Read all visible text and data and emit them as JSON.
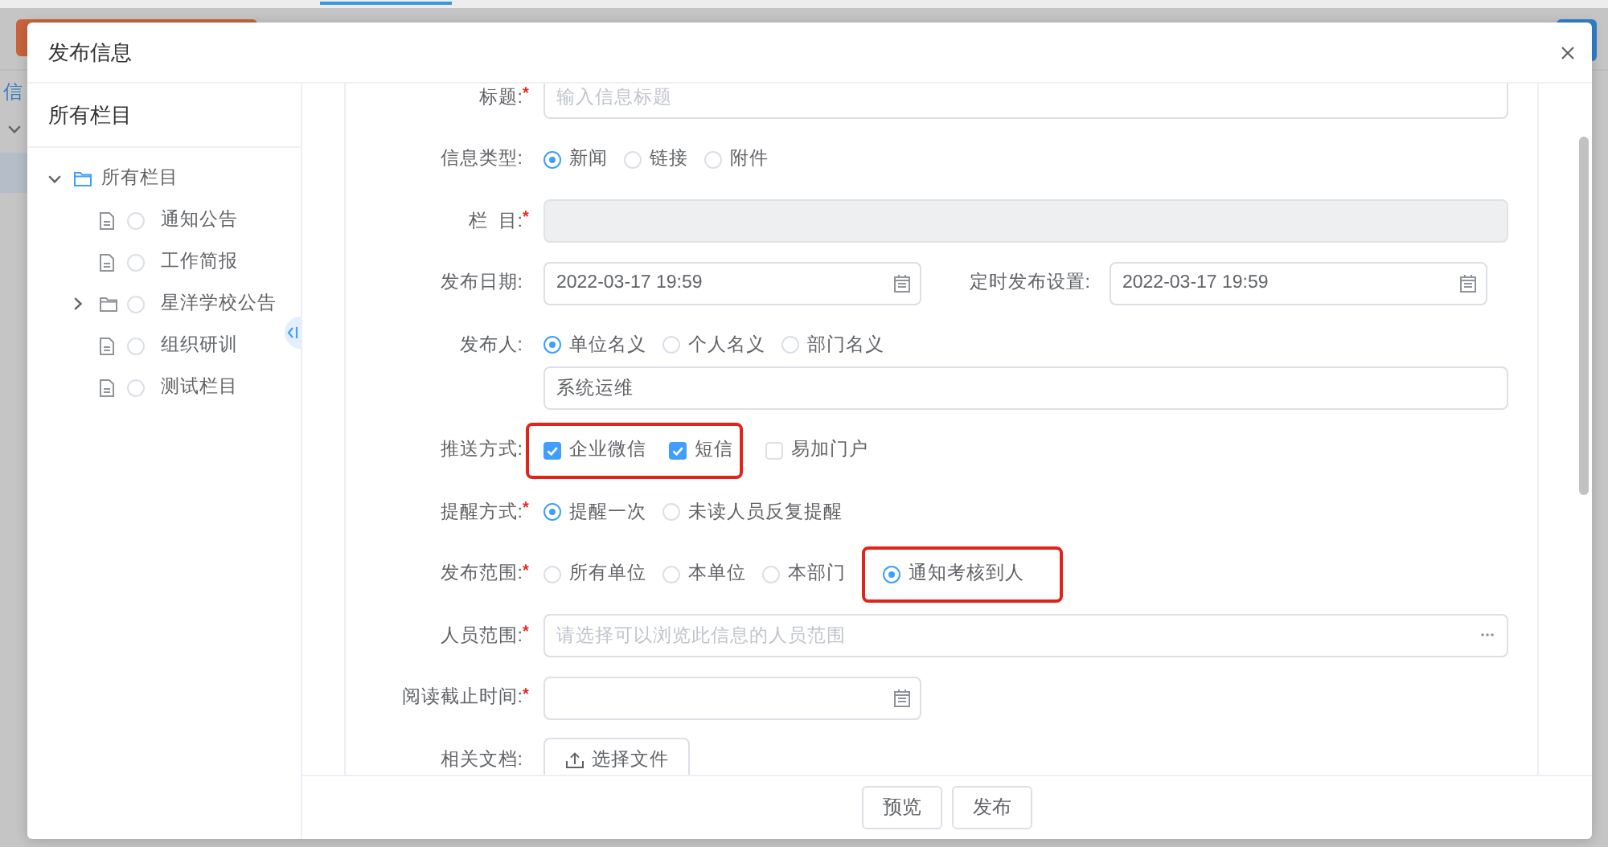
{
  "background_page": {
    "nav_text": "信"
  },
  "dialog": {
    "title": "发布信息",
    "tree": {
      "header": "所有栏目",
      "items": [
        {
          "label": "所有栏目",
          "kind": "folder",
          "expanded": true,
          "children": [
            {
              "label": "通知公告",
              "kind": "file",
              "selected": false
            },
            {
              "label": "工作简报",
              "kind": "file",
              "selected": false
            },
            {
              "label": "星洋学校公告",
              "kind": "folder",
              "expanded": false,
              "selected": false
            },
            {
              "label": "组织研训",
              "kind": "file",
              "selected": false
            },
            {
              "label": "测试栏目",
              "kind": "file",
              "selected": false
            }
          ]
        }
      ]
    },
    "form": {
      "fields": [
        {
          "kind": "text",
          "label": "标题:",
          "mark": "*",
          "placeholder": "输入信息标题",
          "disabled": false
        },
        {
          "kind": "radio",
          "label": "信息类型:",
          "options": [
            {
              "label": "新闻",
              "selected": true
            },
            {
              "label": "链接",
              "selected": false
            },
            {
              "label": "附件",
              "selected": false
            }
          ]
        },
        {
          "kind": "text",
          "label": "栏  目:",
          "mark": "*",
          "disabled": true
        },
        {
          "kind": "date",
          "label": "发布日期:",
          "value": "2022-03-17 19:59",
          "side": {
            "label": "定时发布设置:",
            "value": "2022-03-17 19:59"
          }
        },
        {
          "kind": "radio",
          "label": "发布人:",
          "options": [
            {
              "label": "单位名义",
              "selected": true
            },
            {
              "label": "个人名义",
              "selected": false
            },
            {
              "label": "部门名义",
              "selected": false
            }
          ],
          "value": "系统运维"
        },
        {
          "kind": "checkbox",
          "label": "推送方式:",
          "options": [
            {
              "label": "企业微信",
              "checked": true,
              "highlighted": true
            },
            {
              "label": "短信",
              "checked": true,
              "highlighted": true
            },
            {
              "label": "易加门户",
              "checked": false,
              "highlighted": false
            }
          ]
        },
        {
          "kind": "radio",
          "label": "提醒方式:",
          "mark": "*",
          "options": [
            {
              "label": "提醒一次",
              "selected": true
            },
            {
              "label": "未读人员反复提醒",
              "selected": false
            }
          ]
        },
        {
          "kind": "radio",
          "label": "发布范围:",
          "mark": "*",
          "options": [
            {
              "label": "所有单位",
              "selected": false,
              "highlighted": false
            },
            {
              "label": "本单位",
              "selected": false,
              "highlighted": false
            },
            {
              "label": "本部门",
              "selected": false,
              "highlighted": false
            },
            {
              "label": "通知考核到人",
              "selected": true,
              "highlighted": true
            }
          ]
        },
        {
          "kind": "picker",
          "label": "人员范围:",
          "mark": "*",
          "placeholder": "请选择可以浏览此信息的人员范围"
        },
        {
          "kind": "date",
          "label": "阅读截止时间:",
          "mark": "*"
        },
        {
          "kind": "upload",
          "label": "相关文档:",
          "button": "选择文件"
        }
      ]
    },
    "footer": {
      "buttons": [
        "预览",
        "发布"
      ]
    }
  }
}
